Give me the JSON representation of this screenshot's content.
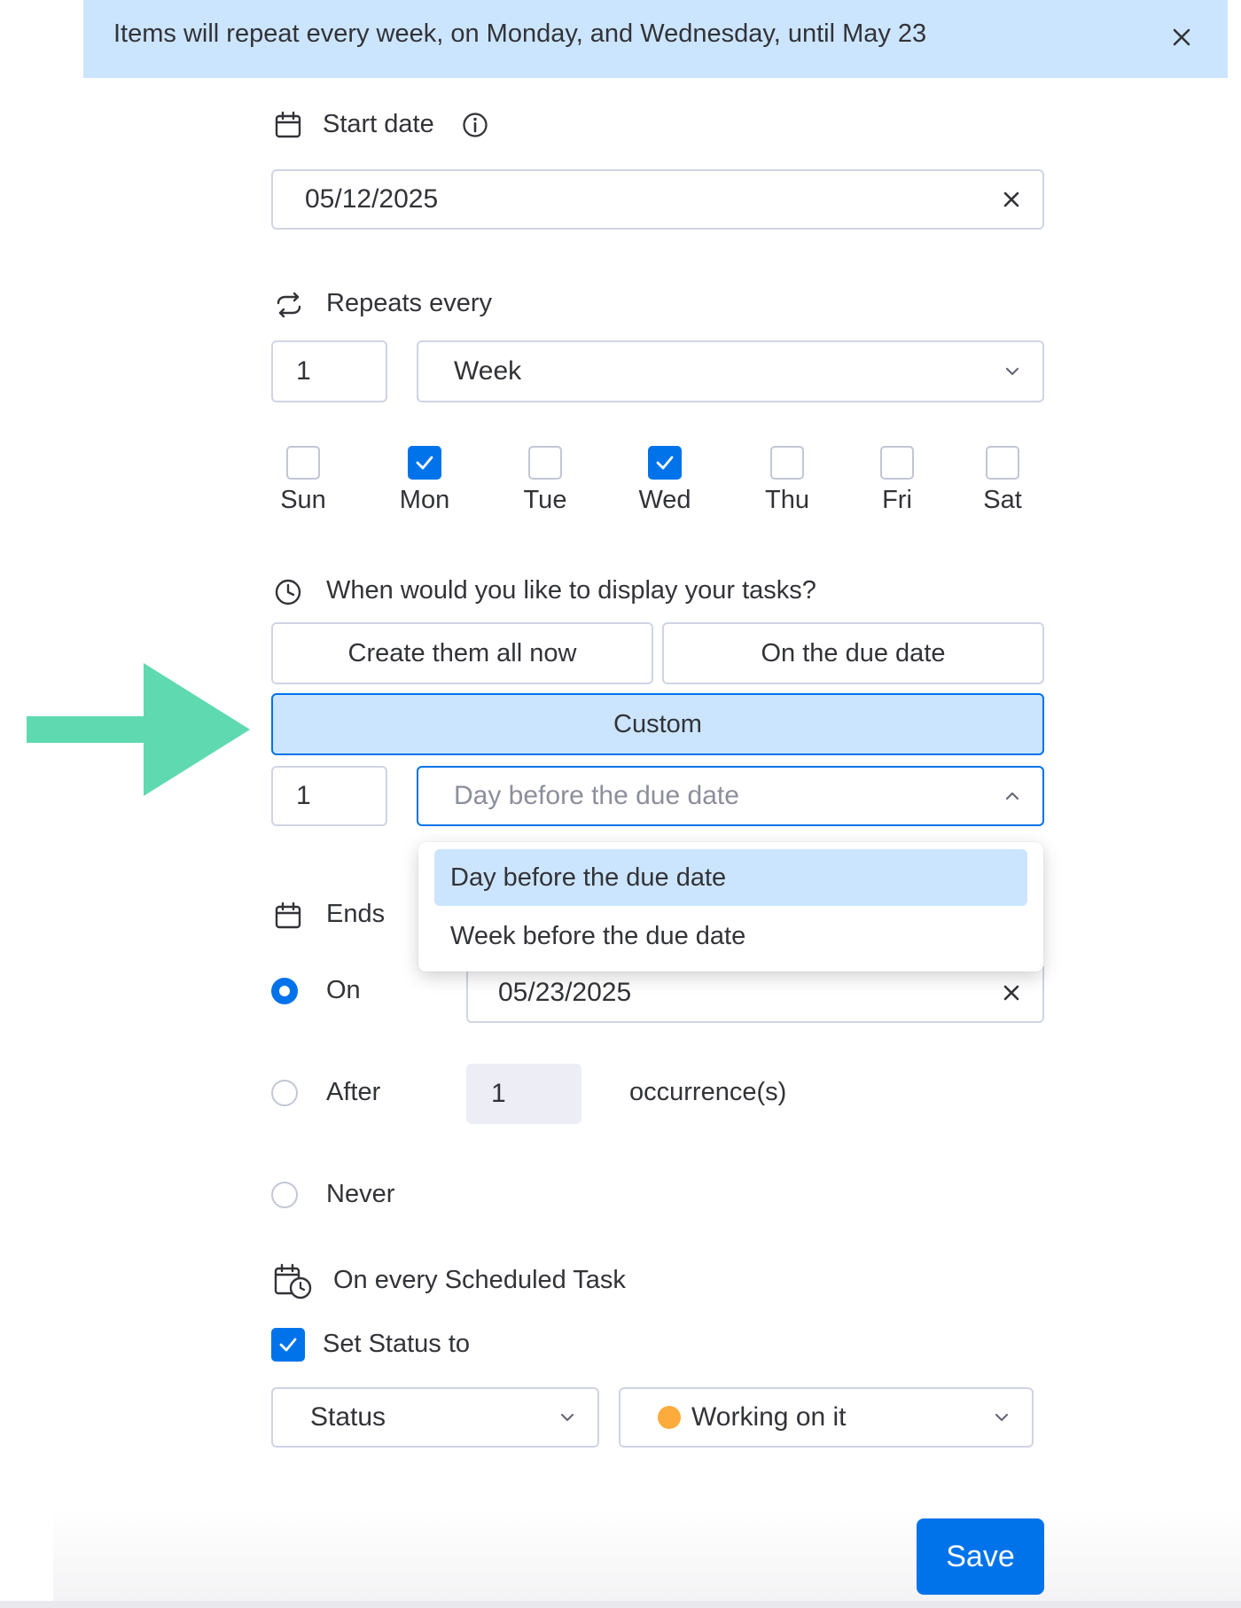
{
  "banner": {
    "text": "Items will repeat every week, on Monday, and Wednesday, until May 23"
  },
  "start_date": {
    "label": "Start date",
    "value": "05/12/2025"
  },
  "repeats": {
    "label": "Repeats every",
    "interval": "1",
    "unit": "Week",
    "days": [
      {
        "label": "Sun",
        "checked": false
      },
      {
        "label": "Mon",
        "checked": true
      },
      {
        "label": "Tue",
        "checked": false
      },
      {
        "label": "Wed",
        "checked": true
      },
      {
        "label": "Thu",
        "checked": false
      },
      {
        "label": "Fri",
        "checked": false
      },
      {
        "label": "Sat",
        "checked": false
      }
    ]
  },
  "display": {
    "question": "When would you like to display your tasks?",
    "options": [
      "Create them all now",
      "On the due date",
      "Custom"
    ],
    "selected": "Custom",
    "custom_count": "1",
    "custom_unit": "Day before the due date",
    "dropdown_options": [
      "Day before the due date",
      "Week before the due date"
    ],
    "dropdown_highlighted": "Day before the due date"
  },
  "ends": {
    "label": "Ends",
    "selected": "On",
    "on_label": "On",
    "on_date": "05/23/2025",
    "after_label": "After",
    "after_count": "1",
    "occurrences_label": "occurrence(s)",
    "never_label": "Never"
  },
  "scheduled": {
    "label": "On every Scheduled Task",
    "set_status_label": "Set Status to",
    "set_status_checked": true,
    "column": "Status",
    "status_value": "Working on it",
    "status_color": "#fdab3d"
  },
  "save_label": "Save",
  "colors": {
    "accent": "#0073ea",
    "banner_bg": "#cce5ff",
    "arrow": "#5fd9b0"
  }
}
